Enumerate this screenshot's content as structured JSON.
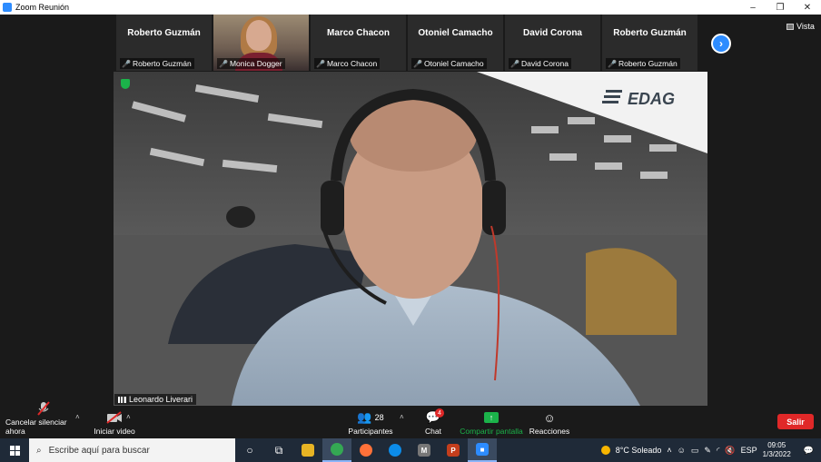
{
  "window": {
    "title": "Zoom Reunión",
    "minimize": "–",
    "restore": "❐",
    "close": "✕"
  },
  "strip": {
    "tiles": [
      {
        "big": "Roberto Guzmán",
        "small": "Roberto Guzmán"
      },
      {
        "big": "",
        "small": "Monica Dogger",
        "video": true
      },
      {
        "big": "Marco Chacon",
        "small": "Marco Chacon"
      },
      {
        "big": "Otoniel Camacho",
        "small": "Otoniel Camacho"
      },
      {
        "big": "David Corona",
        "small": "David Corona"
      },
      {
        "big": "Roberto Guzmán",
        "small": "Roberto Guzmán"
      }
    ],
    "next_icon": "chevron-right-icon"
  },
  "view": {
    "label": "Vista"
  },
  "speaker": {
    "name": "Leonardo Liverari",
    "brand": "EDAG"
  },
  "toolbar": {
    "unmute": "Cancelar silenciar ahora",
    "video": "Iniciar video",
    "participants": "Participantes",
    "participants_count": "28",
    "chat": "Chat",
    "chat_badge": "4",
    "share": "Compartir pantalla",
    "reactions": "Reacciones",
    "leave": "Salir"
  },
  "taskbar": {
    "search_placeholder": "Escribe aquí para buscar",
    "weather": "8°C  Soleado",
    "lang": "ESP",
    "time": "09:05",
    "date": "1/3/2022"
  },
  "colors": {
    "accent": "#2d8cff",
    "leave": "#e02828",
    "share": "#1bb34a"
  }
}
